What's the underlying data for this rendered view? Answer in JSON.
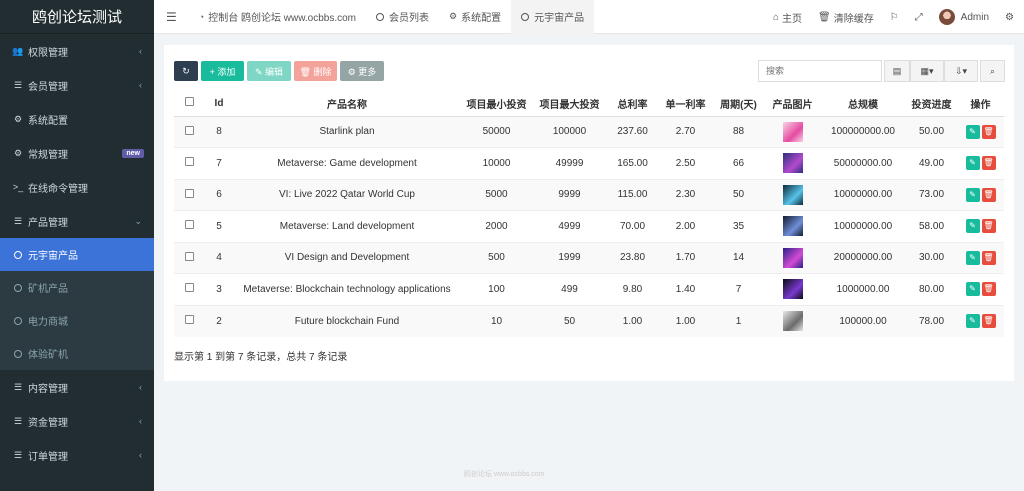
{
  "brand": "鸥创论坛测试",
  "sidebar": {
    "items": [
      {
        "label": "权限管理",
        "icon": "users-icon",
        "glyph": "👥",
        "arrow": "‹"
      },
      {
        "label": "会员管理",
        "icon": "list-icon",
        "glyph": "☰",
        "arrow": "‹"
      },
      {
        "label": "系统配置",
        "icon": "gear-icon",
        "glyph": "⚙",
        "arrow": ""
      },
      {
        "label": "常规管理",
        "icon": "cogs-icon",
        "glyph": "⚙",
        "badge": "new"
      },
      {
        "label": "在线命令管理",
        "icon": "terminal-icon",
        "glyph": ">_",
        "arrow": ""
      },
      {
        "label": "产品管理",
        "icon": "list-icon",
        "glyph": "☰",
        "arrow": "⌄"
      }
    ],
    "sub_items": [
      {
        "label": "元宇宙产品",
        "active": true
      },
      {
        "label": "矿机产品"
      },
      {
        "label": "电力商城"
      },
      {
        "label": "体验矿机"
      }
    ],
    "items_bottom": [
      {
        "label": "内容管理",
        "icon": "list-icon",
        "glyph": "☰",
        "arrow": "‹"
      },
      {
        "label": "资金管理",
        "icon": "list-icon",
        "glyph": "☰",
        "arrow": "‹"
      },
      {
        "label": "订单管理",
        "icon": "list-icon",
        "glyph": "☰",
        "arrow": "‹"
      }
    ]
  },
  "topnav": {
    "menu_icon": "☰",
    "tabs": [
      {
        "label": "控制台 鸥创论坛 www.ocbbs.com",
        "icon": "dashboard-icon"
      },
      {
        "label": "会员列表",
        "icon": "circle-icon"
      },
      {
        "label": "系统配置",
        "icon": "gear-icon"
      },
      {
        "label": "元宇宙产品",
        "icon": "circle-icon",
        "active": true
      }
    ],
    "home": "主页",
    "clear_cache": "清除缓存",
    "admin": "Admin"
  },
  "toolbar": {
    "refresh": "↻",
    "add": "+ 添加",
    "edit": "✎ 编辑",
    "delete": "🗑 删除",
    "more": "⚙ 更多",
    "search_placeholder": "搜索"
  },
  "table": {
    "headers": [
      "Id",
      "产品名称",
      "项目最小投资",
      "项目最大投资",
      "总利率",
      "单一利率",
      "周期(天)",
      "产品图片",
      "总规模",
      "投资进度",
      "操作"
    ],
    "rows": [
      {
        "id": "8",
        "name": "Starlink plan",
        "min": "50000",
        "max": "100000",
        "total_rate": "237.60",
        "single_rate": "2.70",
        "cycle": "88",
        "total_scale": "100000000.00",
        "progress": "50.00",
        "thumb_colors": [
          "#f7d3e6",
          "#e64aa0"
        ]
      },
      {
        "id": "7",
        "name": "Metaverse: Game development",
        "min": "10000",
        "max": "49999",
        "total_rate": "165.00",
        "single_rate": "2.50",
        "cycle": "66",
        "total_scale": "50000000.00",
        "progress": "49.00",
        "thumb_colors": [
          "#2b2f7a",
          "#b44ad0"
        ]
      },
      {
        "id": "6",
        "name": "VI: Live 2022 Qatar World Cup",
        "min": "5000",
        "max": "9999",
        "total_rate": "115.00",
        "single_rate": "2.30",
        "cycle": "50",
        "total_scale": "10000000.00",
        "progress": "73.00",
        "thumb_colors": [
          "#0e2a3a",
          "#56c3e8"
        ]
      },
      {
        "id": "5",
        "name": "Metaverse: Land development",
        "min": "2000",
        "max": "4999",
        "total_rate": "70.00",
        "single_rate": "2.00",
        "cycle": "35",
        "total_scale": "10000000.00",
        "progress": "58.00",
        "thumb_colors": [
          "#121a2e",
          "#6f8fd8"
        ]
      },
      {
        "id": "4",
        "name": "VI Design and Development",
        "min": "500",
        "max": "1999",
        "total_rate": "23.80",
        "single_rate": "1.70",
        "cycle": "14",
        "total_scale": "20000000.00",
        "progress": "30.00",
        "thumb_colors": [
          "#2a1f8a",
          "#d34bd6"
        ]
      },
      {
        "id": "3",
        "name": "Metaverse: Blockchain technology applications",
        "min": "100",
        "max": "499",
        "total_rate": "9.80",
        "single_rate": "1.40",
        "cycle": "7",
        "total_scale": "1000000.00",
        "progress": "80.00",
        "thumb_colors": [
          "#0a0a14",
          "#7a3ad0"
        ]
      },
      {
        "id": "2",
        "name": "Future blockchain Fund",
        "min": "10",
        "max": "50",
        "total_rate": "1.00",
        "single_rate": "1.00",
        "cycle": "1",
        "total_scale": "100000.00",
        "progress": "78.00",
        "thumb_colors": [
          "#e8e8e8",
          "#6a6a6a"
        ]
      }
    ]
  },
  "pagination_info": "显示第 1 到第 7 条记录，总共 7 条记录",
  "footer": "鸥创论坛 www.ocbbs.com"
}
